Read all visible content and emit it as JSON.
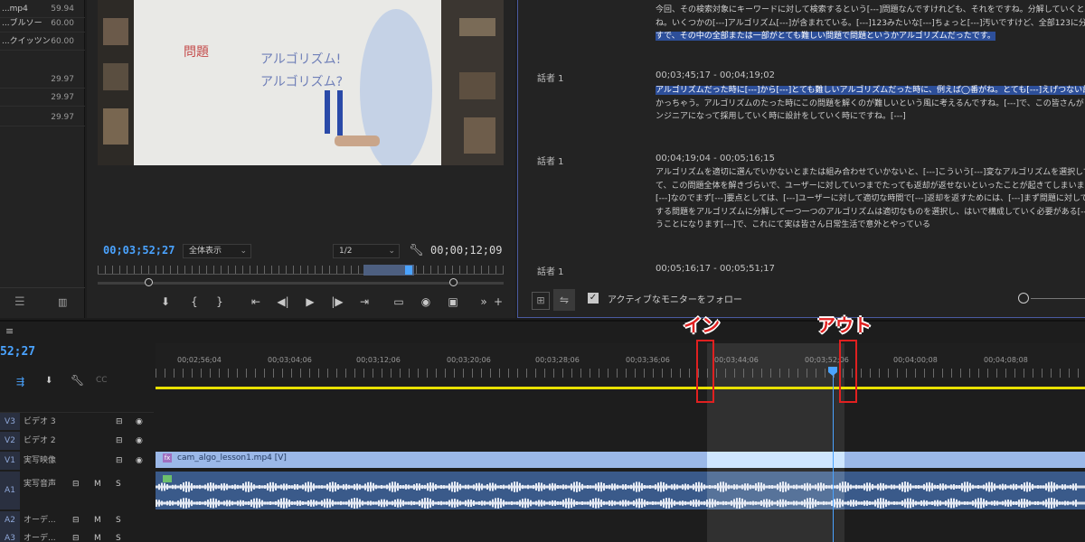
{
  "project": {
    "items": [
      {
        "name": "...mp4",
        "fps": "59.94"
      },
      {
        "name": "...ブルソー",
        "fps": "60.00"
      },
      {
        "name": "...クイッツン",
        "fps": "60.00"
      },
      {
        "name": "",
        "fps": "29.97"
      },
      {
        "name": "",
        "fps": "29.97"
      },
      {
        "name": "",
        "fps": "29.97"
      }
    ]
  },
  "monitor": {
    "timecode_current": "00;03;52;27",
    "zoom_select": "全体表示",
    "quality_select": "1/2",
    "timecode_duration": "00;00;12;09"
  },
  "text_panel": {
    "top_lines": [
      "今回、その検索対象にキーワードに対して検索するという[---]問題なんですけれども、それをですね。分解していくと必ず",
      "ね。いくつかの[---]アルゴリズム[---]が含まれている。[---]123みたいな[---]ちょっと[---]汚いですけど、全部123に分解できた",
      "すで、その中の全部または一部がとても難しい問題で問題というかアルゴリズムだったです。"
    ],
    "blocks": [
      {
        "speaker": "話者 1",
        "range": "00;03;45;17 - 00;04;19;02",
        "lines": [
          "アルゴリズムだった時に[---]から[---]とても難しいアルゴリズムだった時に、例えば◯番がね。とても[---]えげつない計算時間が",
          "かっちゃう。アルゴリズムのたった時にこの問題を解くのが難しいという風に考えるんですね。[---]で、この皆さんがこれから",
          "ンジニアになって採用していく時に設計をしていく時にですね。[---]"
        ]
      },
      {
        "speaker": "話者 1",
        "range": "00;04;19;04 - 00;05;16;15",
        "lines": [
          "アルゴリズムを適切に選んでいかないとまたは組み合わせていかないと、[---]こういう[---]変なアルゴリズムを選択してしまっ",
          "て、この問題全体を解きづらいで、ユーザーに対していつまでたっても返却が返せないといったことが起きてしまいます。はい",
          "[---]なのでまず[---]要点としては、[---]ユーザーに対して適切な時間で[---]返却を返すためには、[---]まず問題に対して着目",
          "する問題をアルゴリズムに分解して一つ一つのアルゴリズムは適切なものを選択し、はいで構成していく必要がある[---]と",
          "うことになります[---]で、これにて実は皆さん日常生活で意外とやっている"
        ]
      },
      {
        "speaker": "話者 1",
        "range": "00;05;16;17 - 00;05;51;17",
        "lines": []
      }
    ],
    "follow_label": "アクティブなモニターをフォロー"
  },
  "timeline": {
    "timecode": "52;27",
    "ruler_ticks": [
      "00;02;56;04",
      "00;03;04;06",
      "00;03;12;06",
      "00;03;20;06",
      "00;03;28;06",
      "00;03;36;06",
      "00;03;44;06",
      "00;03;52;06",
      "00;04;00;08",
      "00;04;08;08"
    ],
    "tracks": [
      {
        "id": "V3",
        "name": "ビデオ 3"
      },
      {
        "id": "V2",
        "name": "ビデオ 2"
      },
      {
        "id": "V1",
        "name": "実写映像"
      },
      {
        "id": "A1",
        "name": "実写音声"
      },
      {
        "id": "A2",
        "name": "オーデ..."
      },
      {
        "id": "A3",
        "name": "オーデ..."
      }
    ],
    "clip_video": "cam_algo_lesson1.mp4 [V]",
    "annotation_in": "イン",
    "annotation_out": "アウト",
    "track_m": "M",
    "track_s": "S"
  }
}
